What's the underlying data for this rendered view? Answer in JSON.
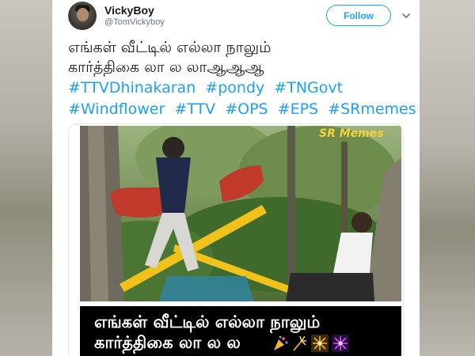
{
  "tweet": {
    "display_name": "VickyBoy",
    "handle": "@TomVickyboy",
    "follow_label": "Follow",
    "text_lines": [
      "எங்கள் வீட்டில் எல்லா நாலும்",
      "கார்த்திகை லா ல லாஆஆஆ"
    ],
    "hashtag_rows": [
      [
        "#TTVDhinakaran",
        "#pondy",
        "#TNGovt"
      ],
      [
        "#Windflower",
        "#TTV",
        "#OPS",
        "#EPS",
        "#SRmemes"
      ]
    ]
  },
  "media": {
    "watermark": "SR Memes",
    "caption_lines": [
      "எங்கள் வீட்டில் எல்லா நாலும்",
      "கார்த்திகை லா ல ல"
    ],
    "caption_emojis": [
      "party-popper-icon",
      "sparkler-icon",
      "firework-icon",
      "firework-icon"
    ]
  },
  "colors": {
    "link": "#1da1f2",
    "text": "#14171a",
    "muted": "#657786",
    "caption_bg": "#000000"
  }
}
